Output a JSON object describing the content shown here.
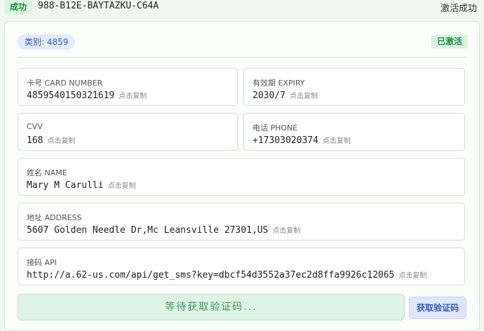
{
  "topbar": {
    "status": "成功",
    "code": "988-B12E-BAYTAZKU-C64A",
    "activated": "激活成功"
  },
  "card": {
    "category": "类别: 4859",
    "status": "已激活",
    "copy_hint": "点击复制",
    "fields": {
      "card_number": {
        "label": "卡号 CARD NUMBER",
        "value": "4859540150321619"
      },
      "expiry": {
        "label": "有效期 EXPIRY",
        "value": "2030/7"
      },
      "cvv": {
        "label": "CVV",
        "value": "168"
      },
      "phone": {
        "label": "电话 PHONE",
        "value": "+17303020374"
      },
      "name": {
        "label": "姓名 NAME",
        "value": "Mary M Carulli"
      },
      "address": {
        "label": "地址 ADDRESS",
        "value": "5607 Golden Needle Dr,Mc Leansville 27301,US"
      },
      "api": {
        "label": "接码 API",
        "value": "http://a.62-us.com/api/get_sms?key=dbcf54d3552a37ec2d8ffa9926c12065"
      }
    },
    "waiting": "等待获取验证码...",
    "get_code_button": "获取验证码"
  }
}
